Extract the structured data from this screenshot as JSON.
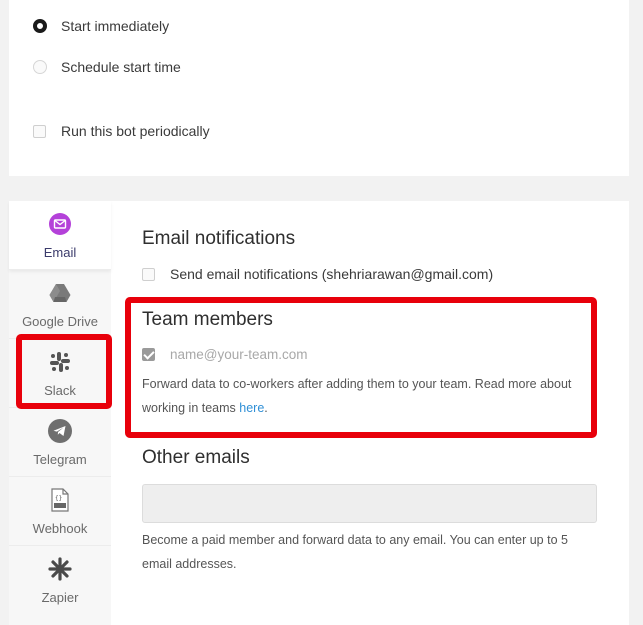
{
  "start_options": {
    "immediate_label": "Start immediately",
    "schedule_label": "Schedule start time",
    "periodic_label": "Run this bot periodically",
    "selected": "immediate"
  },
  "sidebar": {
    "items": [
      {
        "label": "Email",
        "icon": "envelope-icon",
        "active": true
      },
      {
        "label": "Google Drive",
        "icon": "google-drive-icon",
        "active": false
      },
      {
        "label": "Slack",
        "icon": "slack-icon",
        "active": false
      },
      {
        "label": "Telegram",
        "icon": "telegram-icon",
        "active": false
      },
      {
        "label": "Webhook",
        "icon": "json-file-icon",
        "active": false
      },
      {
        "label": "Zapier",
        "icon": "zapier-icon",
        "active": false
      }
    ]
  },
  "email_notifications": {
    "title": "Email notifications",
    "checkbox_label": "Send email notifications (shehriarawan@gmail.com)",
    "checked": false
  },
  "team_members": {
    "title": "Team members",
    "placeholder_email": "name@your-team.com",
    "checked": true,
    "description": "Forward data to co-workers after adding them to your team. Read more about working in teams ",
    "link_text": "here",
    "description_end": "."
  },
  "other_emails": {
    "title": "Other emails",
    "input_value": "",
    "description": "Become a paid member and forward data to any email. You can enter up to 5 email addresses."
  },
  "colors": {
    "highlight": "#e8000b",
    "email_icon": "#b441d9",
    "link": "#2f8fd6"
  }
}
